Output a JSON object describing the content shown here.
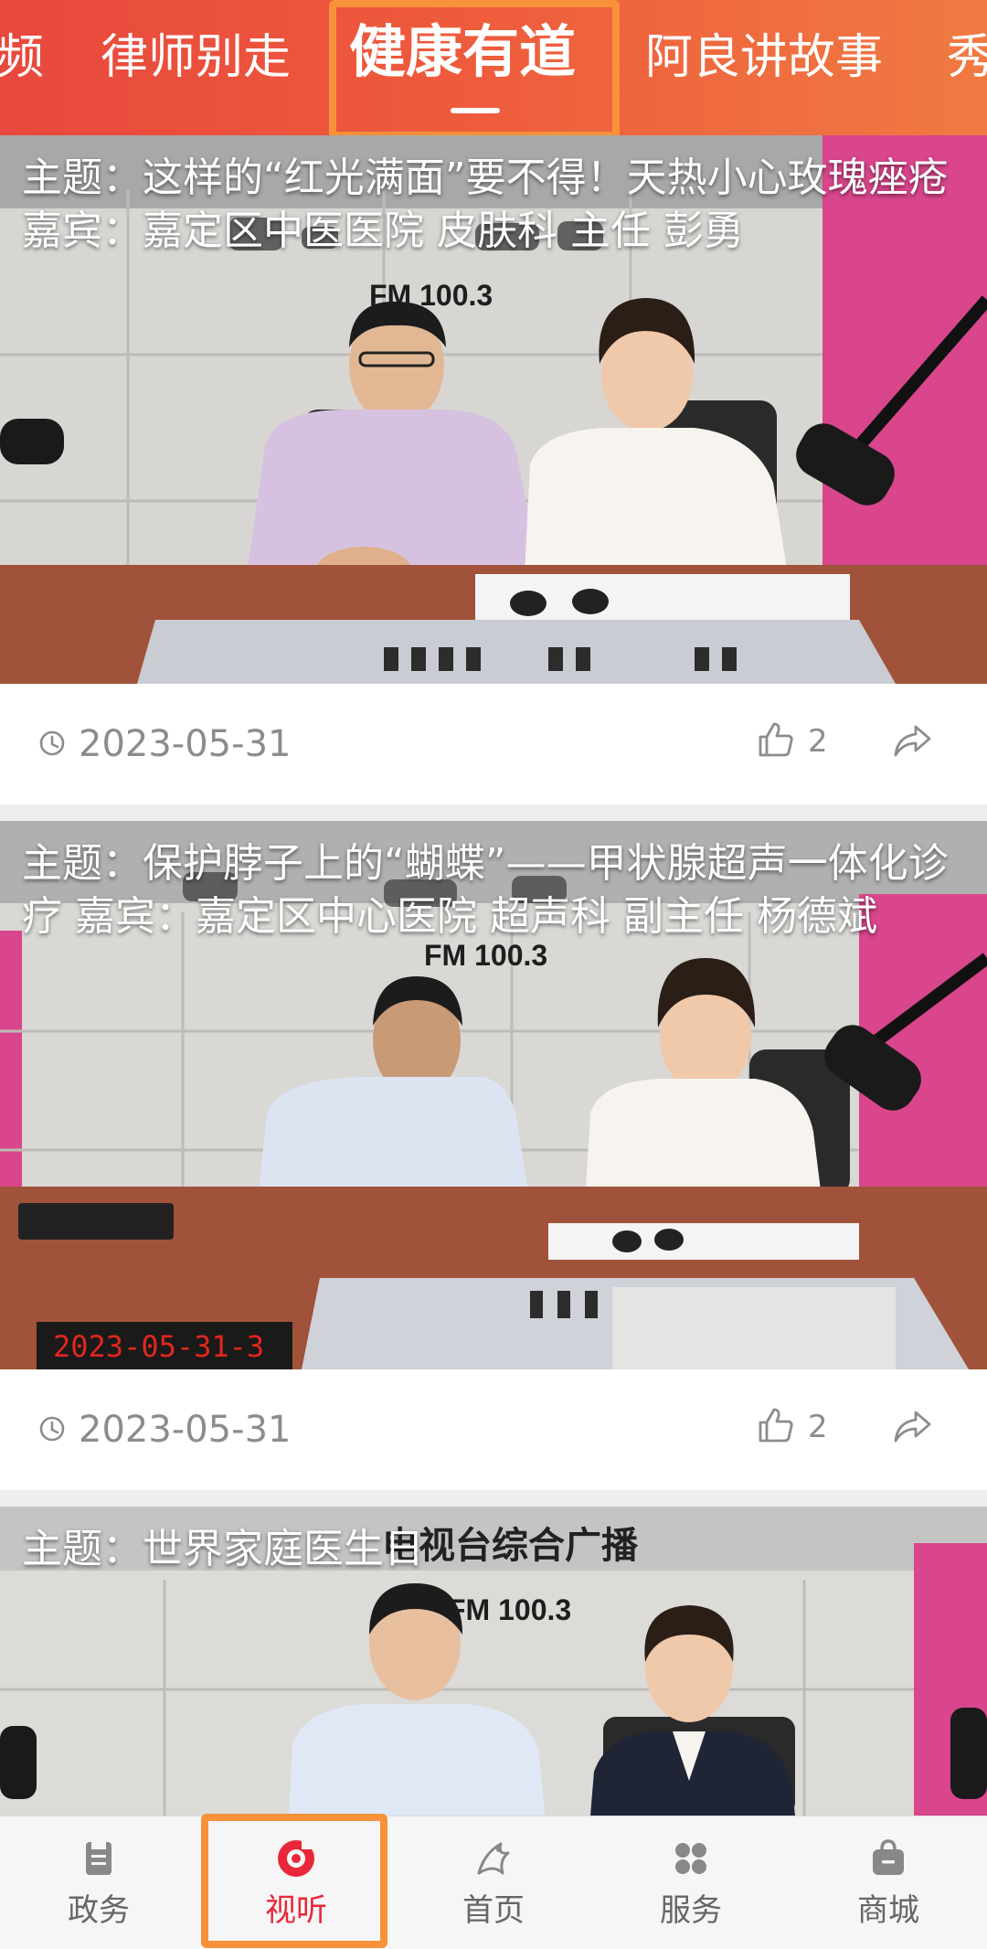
{
  "top_tabs": {
    "items": [
      {
        "label": "频"
      },
      {
        "label": "律师别走"
      },
      {
        "label": "健康有道",
        "active": true
      },
      {
        "label": "阿良讲故事"
      },
      {
        "label": "秀"
      }
    ]
  },
  "feed": {
    "cards": [
      {
        "title": "主题：这样的“红光满面”要不得！天热小心玫瑰痤疮  嘉宾：嘉定区中医医院 皮肤科 主任 彭勇",
        "studio_sign": "FM 100.3",
        "date": "2023-05-31",
        "likes": "2"
      },
      {
        "title": "主题：保护脖子上的“蝴蝶”——甲状腺超声一体化诊疗  嘉宾：嘉定区中心医院 超声科 副主任 杨德斌",
        "studio_sign": "FM 100.3",
        "desk_clock": "2023-05-31-3",
        "date": "2023-05-31",
        "likes": "2"
      },
      {
        "title": "主题：世界家庭医生日",
        "studio_sign": "FM 100.3",
        "wall_text": "电视台综合广播"
      }
    ]
  },
  "bottom_nav": {
    "items": [
      {
        "label": "政务",
        "icon": "document-icon"
      },
      {
        "label": "视听",
        "icon": "play-circle-icon",
        "active": true
      },
      {
        "label": "首页",
        "icon": "home-logo-icon"
      },
      {
        "label": "服务",
        "icon": "grid-icon"
      },
      {
        "label": "商城",
        "icon": "shopping-bag-icon"
      }
    ]
  },
  "colors": {
    "header_start": "#e8483d",
    "header_end": "#f07a42",
    "highlight": "#f7913a",
    "active_nav": "#e8283a",
    "meta_text": "#8c8c8c"
  }
}
